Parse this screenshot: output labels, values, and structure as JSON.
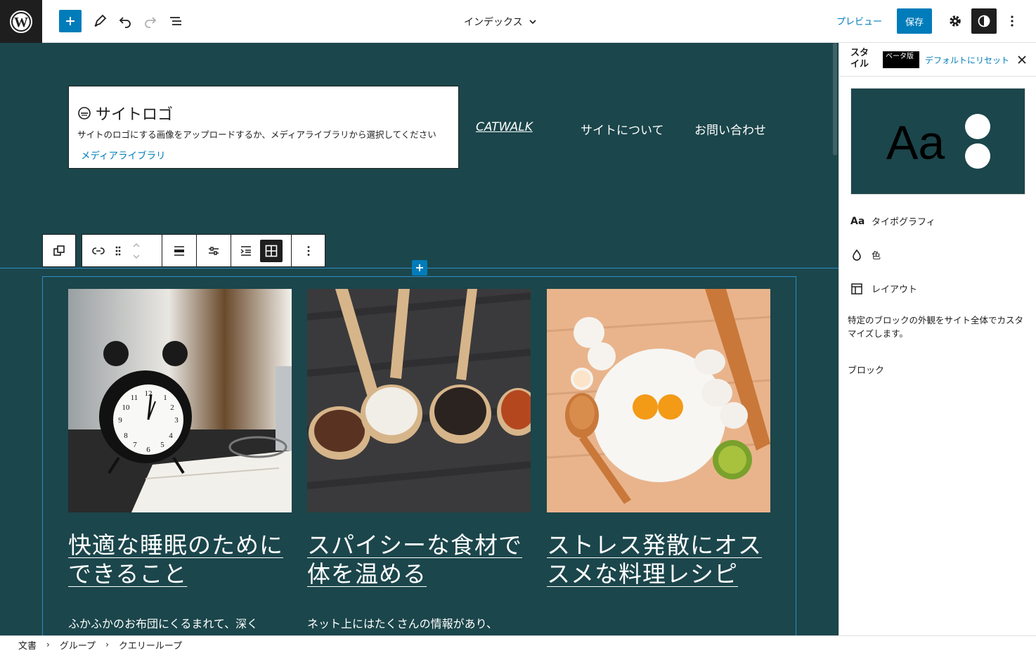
{
  "topbar": {
    "document_title": "インデックス",
    "preview_label": "プレビュー",
    "save_label": "保存"
  },
  "header": {
    "site_logo": {
      "title": "サイトロゴ",
      "description": "サイトのロゴにする画像をアップロードするか、メディアライブラリから選択してください",
      "media_library_label": "メディアライブラリ"
    },
    "nav": {
      "items": [
        {
          "label": "CATWALK"
        },
        {
          "label": "サイトについて"
        },
        {
          "label": "お問い合わせ"
        }
      ]
    }
  },
  "posts": [
    {
      "title": "快適な睡眠のためにできること",
      "excerpt": "ふかふかのお布団にくるまれて、深く",
      "image": "alarm-clock-photo"
    },
    {
      "title": "スパイシーな食材で体を温める",
      "excerpt": "ネット上にはたくさんの情報があり、",
      "image": "spice-spoons-photo"
    },
    {
      "title": "ストレス発散にオススメな料理レシピ",
      "excerpt": "",
      "image": "baking-flour-eggs-photo"
    }
  ],
  "sidebar": {
    "title": "スタイル",
    "beta_badge": "ベータ版",
    "reset_label": "デフォルトにリセット",
    "preview_text": "Aa",
    "items": [
      {
        "icon": "typography-icon",
        "icon_text": "Aa",
        "label": "タイポグラフィ"
      },
      {
        "icon": "droplet-icon",
        "label": "色"
      },
      {
        "icon": "layout-icon",
        "label": "レイアウト"
      }
    ],
    "description": "特定のブロックの外観をサイト全体でカスタマイズします。",
    "blocks_label": "ブロック"
  },
  "breadcrumb": {
    "items": [
      "文書",
      "グループ",
      "クエリーループ"
    ]
  },
  "colors": {
    "canvas_bg": "#1b464b",
    "accent": "#007cba",
    "dark": "#1e1e1e"
  }
}
